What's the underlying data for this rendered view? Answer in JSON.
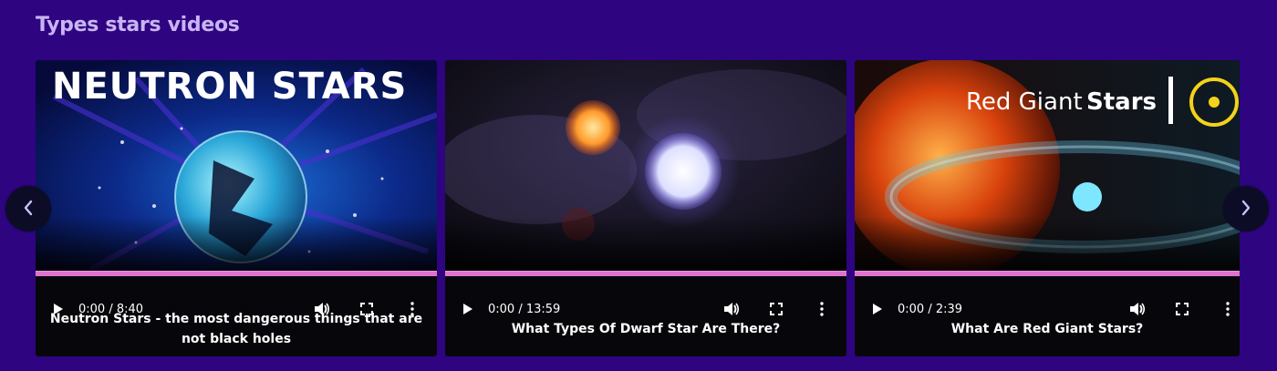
{
  "section": {
    "title": "Types stars videos"
  },
  "nav": {
    "prev_icon": "chevron-left-icon",
    "next_icon": "chevron-right-icon"
  },
  "videos": [
    {
      "thumbnail_title": "NEUTRON STARS",
      "time": "0:00 / 8:40",
      "caption": "Neutron Stars - the most dangerous things that are not black holes"
    },
    {
      "thumbnail_title": "",
      "time": "0:00 / 13:59",
      "caption": "What Types Of Dwarf Star Are There?"
    },
    {
      "thumbnail_title_light": "Red Giant",
      "thumbnail_title_bold": "Stars",
      "time": "0:00 / 2:39",
      "caption": "What Are Red Giant Stars?"
    }
  ],
  "colors": {
    "page_background": "#2e0480",
    "section_title": "#c9b4f3",
    "progress_bar": "#e072cf",
    "card_background": "#07070b",
    "nav_button": "#0c0c26"
  }
}
